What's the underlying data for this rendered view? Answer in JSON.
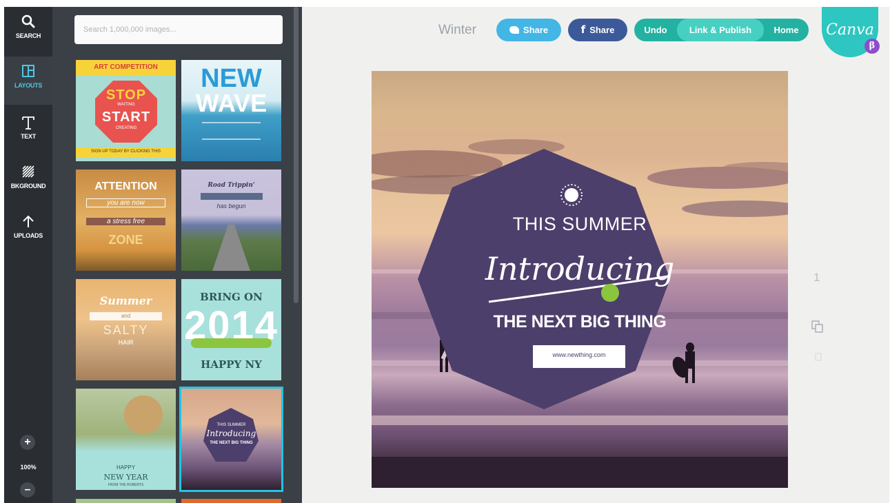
{
  "sidebar": {
    "items": [
      {
        "label": "SEARCH",
        "icon": "search-icon"
      },
      {
        "label": "LAYOUTS",
        "icon": "layout-icon"
      },
      {
        "label": "TEXT",
        "icon": "text-icon"
      },
      {
        "label": "BKGROUND",
        "icon": "background-icon"
      },
      {
        "label": "UPLOADS",
        "icon": "upload-arrow-icon"
      }
    ],
    "zoom": {
      "in_label": "+",
      "level": "100%",
      "out_label": "–"
    }
  },
  "panel": {
    "search_placeholder": "Search 1,000,000 images...",
    "thumbnails": [
      {
        "name": "art-competition",
        "lines": [
          "ART COMPETITION",
          "STOP",
          "WAITING",
          "START",
          "CREATING",
          "SIGN UP TODAY BY CLICKING THIS"
        ]
      },
      {
        "name": "new-wave",
        "lines": [
          "NEW",
          "WAVE"
        ]
      },
      {
        "name": "attention",
        "lines": [
          "ATTENTION",
          "you are now",
          "a stress free",
          "ZONE"
        ]
      },
      {
        "name": "road-trippin",
        "lines": [
          "Road Trippin'",
          "has begun"
        ]
      },
      {
        "name": "summer-salty",
        "lines": [
          "Summer",
          "and",
          "SALTY",
          "HAIR"
        ]
      },
      {
        "name": "bring-on-2014",
        "lines": [
          "BRING ON",
          "2014",
          "HAPPY NY"
        ]
      },
      {
        "name": "happy-new-year",
        "lines": [
          "HAPPY",
          "NEW YEAR",
          "FROM THE ROBERTS"
        ]
      },
      {
        "name": "this-summer-mini",
        "lines": [
          "THIS SUMMER",
          "Introducing",
          "THE NEXT BIG THING"
        ]
      }
    ]
  },
  "header": {
    "doc_title": "Winter",
    "twitter_share": "Share",
    "facebook_share": "Share",
    "undo": "Undo",
    "publish": "Link & Publish",
    "home": "Home",
    "logo": "Canva",
    "beta": "β"
  },
  "design": {
    "kicker": "THIS SUMMER",
    "script": "Introducing",
    "headline": "THE NEXT BIG THING",
    "url": "www.newthing.com"
  },
  "page_indicator": "1",
  "colors": {
    "rail": "#2a2e33",
    "panel": "#3b4046",
    "accent": "#24c3e3",
    "badge": "#4d3f6b",
    "teal": "#23b2a2",
    "twitter": "#43b6e6",
    "facebook": "#3c5a99",
    "canva": "#2ec6c0"
  }
}
